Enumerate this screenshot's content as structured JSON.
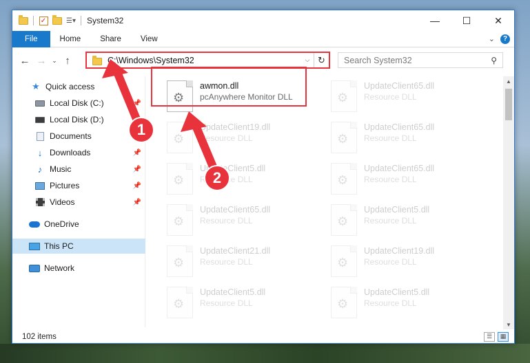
{
  "window": {
    "title": "System32",
    "controls": {
      "minimize": "—",
      "maximize": "☐",
      "close": "✕"
    }
  },
  "ribbon": {
    "tabs": [
      "File",
      "Home",
      "Share",
      "View"
    ],
    "help": "?"
  },
  "navbar": {
    "address": "C:\\Windows\\System32",
    "search_placeholder": "Search System32"
  },
  "sidebar": {
    "items": [
      {
        "label": "Quick access",
        "icon": "star-icon",
        "pinned": false
      },
      {
        "label": "Local Disk (C:)",
        "icon": "drive-icon",
        "pinned": true
      },
      {
        "label": "Local Disk (D:)",
        "icon": "drive-icon",
        "pinned": false
      },
      {
        "label": "Documents",
        "icon": "documents-icon",
        "pinned": true
      },
      {
        "label": "Downloads",
        "icon": "download-icon",
        "pinned": true
      },
      {
        "label": "Music",
        "icon": "music-icon",
        "pinned": true
      },
      {
        "label": "Pictures",
        "icon": "pictures-icon",
        "pinned": true
      },
      {
        "label": "Videos",
        "icon": "videos-icon",
        "pinned": true
      },
      {
        "label": "OneDrive",
        "icon": "onedrive-icon",
        "pinned": false
      },
      {
        "label": "This PC",
        "icon": "computer-icon",
        "pinned": false,
        "selected": true
      },
      {
        "label": "Network",
        "icon": "network-icon",
        "pinned": false
      }
    ]
  },
  "files": {
    "highlighted": {
      "name": "awmon.dll",
      "description": "pcAnywhere Monitor DLL"
    },
    "left_column": [
      {
        "name": "UpdateClient19.dll",
        "description": "Resource DLL"
      },
      {
        "name": "UpdateClient5.dll",
        "description": "Resource DLL"
      },
      {
        "name": "UpdateClient65.dll",
        "description": "Resource DLL"
      },
      {
        "name": "UpdateClient21.dll",
        "description": "Resource DLL"
      },
      {
        "name": "UpdateClient5.dll",
        "description": "Resource DLL"
      }
    ],
    "right_column": [
      {
        "name": "UpdateClient65.dll",
        "description": "Resource DLL"
      },
      {
        "name": "UpdateClient65.dll",
        "description": "Resource DLL"
      },
      {
        "name": "UpdateClient65.dll",
        "description": "Resource DLL"
      },
      {
        "name": "UpdateClient5.dll",
        "description": "Resource DLL"
      },
      {
        "name": "UpdateClient19.dll",
        "description": "Resource DLL"
      },
      {
        "name": "UpdateClient5.dll",
        "description": "Resource DLL"
      }
    ]
  },
  "status": {
    "item_count": "102 items"
  },
  "annotations": {
    "step1": "1",
    "step2": "2",
    "color": "#e8323c"
  }
}
